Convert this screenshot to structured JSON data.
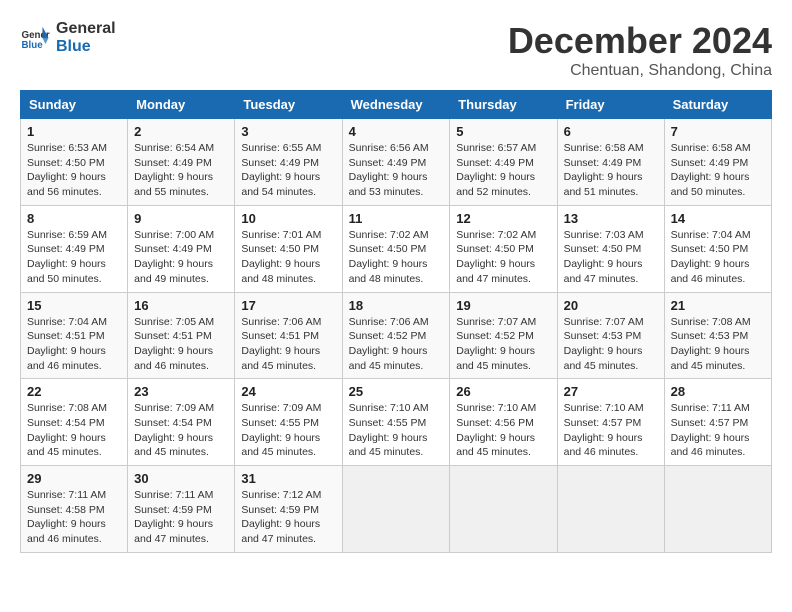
{
  "header": {
    "logo_line1": "General",
    "logo_line2": "Blue",
    "month": "December 2024",
    "location": "Chentuan, Shandong, China"
  },
  "weekdays": [
    "Sunday",
    "Monday",
    "Tuesday",
    "Wednesday",
    "Thursday",
    "Friday",
    "Saturday"
  ],
  "weeks": [
    [
      {
        "day": "1",
        "info": "Sunrise: 6:53 AM\nSunset: 4:50 PM\nDaylight: 9 hours and 56 minutes."
      },
      {
        "day": "2",
        "info": "Sunrise: 6:54 AM\nSunset: 4:49 PM\nDaylight: 9 hours and 55 minutes."
      },
      {
        "day": "3",
        "info": "Sunrise: 6:55 AM\nSunset: 4:49 PM\nDaylight: 9 hours and 54 minutes."
      },
      {
        "day": "4",
        "info": "Sunrise: 6:56 AM\nSunset: 4:49 PM\nDaylight: 9 hours and 53 minutes."
      },
      {
        "day": "5",
        "info": "Sunrise: 6:57 AM\nSunset: 4:49 PM\nDaylight: 9 hours and 52 minutes."
      },
      {
        "day": "6",
        "info": "Sunrise: 6:58 AM\nSunset: 4:49 PM\nDaylight: 9 hours and 51 minutes."
      },
      {
        "day": "7",
        "info": "Sunrise: 6:58 AM\nSunset: 4:49 PM\nDaylight: 9 hours and 50 minutes."
      }
    ],
    [
      {
        "day": "8",
        "info": "Sunrise: 6:59 AM\nSunset: 4:49 PM\nDaylight: 9 hours and 50 minutes."
      },
      {
        "day": "9",
        "info": "Sunrise: 7:00 AM\nSunset: 4:49 PM\nDaylight: 9 hours and 49 minutes."
      },
      {
        "day": "10",
        "info": "Sunrise: 7:01 AM\nSunset: 4:50 PM\nDaylight: 9 hours and 48 minutes."
      },
      {
        "day": "11",
        "info": "Sunrise: 7:02 AM\nSunset: 4:50 PM\nDaylight: 9 hours and 48 minutes."
      },
      {
        "day": "12",
        "info": "Sunrise: 7:02 AM\nSunset: 4:50 PM\nDaylight: 9 hours and 47 minutes."
      },
      {
        "day": "13",
        "info": "Sunrise: 7:03 AM\nSunset: 4:50 PM\nDaylight: 9 hours and 47 minutes."
      },
      {
        "day": "14",
        "info": "Sunrise: 7:04 AM\nSunset: 4:50 PM\nDaylight: 9 hours and 46 minutes."
      }
    ],
    [
      {
        "day": "15",
        "info": "Sunrise: 7:04 AM\nSunset: 4:51 PM\nDaylight: 9 hours and 46 minutes."
      },
      {
        "day": "16",
        "info": "Sunrise: 7:05 AM\nSunset: 4:51 PM\nDaylight: 9 hours and 46 minutes."
      },
      {
        "day": "17",
        "info": "Sunrise: 7:06 AM\nSunset: 4:51 PM\nDaylight: 9 hours and 45 minutes."
      },
      {
        "day": "18",
        "info": "Sunrise: 7:06 AM\nSunset: 4:52 PM\nDaylight: 9 hours and 45 minutes."
      },
      {
        "day": "19",
        "info": "Sunrise: 7:07 AM\nSunset: 4:52 PM\nDaylight: 9 hours and 45 minutes."
      },
      {
        "day": "20",
        "info": "Sunrise: 7:07 AM\nSunset: 4:53 PM\nDaylight: 9 hours and 45 minutes."
      },
      {
        "day": "21",
        "info": "Sunrise: 7:08 AM\nSunset: 4:53 PM\nDaylight: 9 hours and 45 minutes."
      }
    ],
    [
      {
        "day": "22",
        "info": "Sunrise: 7:08 AM\nSunset: 4:54 PM\nDaylight: 9 hours and 45 minutes."
      },
      {
        "day": "23",
        "info": "Sunrise: 7:09 AM\nSunset: 4:54 PM\nDaylight: 9 hours and 45 minutes."
      },
      {
        "day": "24",
        "info": "Sunrise: 7:09 AM\nSunset: 4:55 PM\nDaylight: 9 hours and 45 minutes."
      },
      {
        "day": "25",
        "info": "Sunrise: 7:10 AM\nSunset: 4:55 PM\nDaylight: 9 hours and 45 minutes."
      },
      {
        "day": "26",
        "info": "Sunrise: 7:10 AM\nSunset: 4:56 PM\nDaylight: 9 hours and 45 minutes."
      },
      {
        "day": "27",
        "info": "Sunrise: 7:10 AM\nSunset: 4:57 PM\nDaylight: 9 hours and 46 minutes."
      },
      {
        "day": "28",
        "info": "Sunrise: 7:11 AM\nSunset: 4:57 PM\nDaylight: 9 hours and 46 minutes."
      }
    ],
    [
      {
        "day": "29",
        "info": "Sunrise: 7:11 AM\nSunset: 4:58 PM\nDaylight: 9 hours and 46 minutes."
      },
      {
        "day": "30",
        "info": "Sunrise: 7:11 AM\nSunset: 4:59 PM\nDaylight: 9 hours and 47 minutes."
      },
      {
        "day": "31",
        "info": "Sunrise: 7:12 AM\nSunset: 4:59 PM\nDaylight: 9 hours and 47 minutes."
      },
      null,
      null,
      null,
      null
    ]
  ]
}
